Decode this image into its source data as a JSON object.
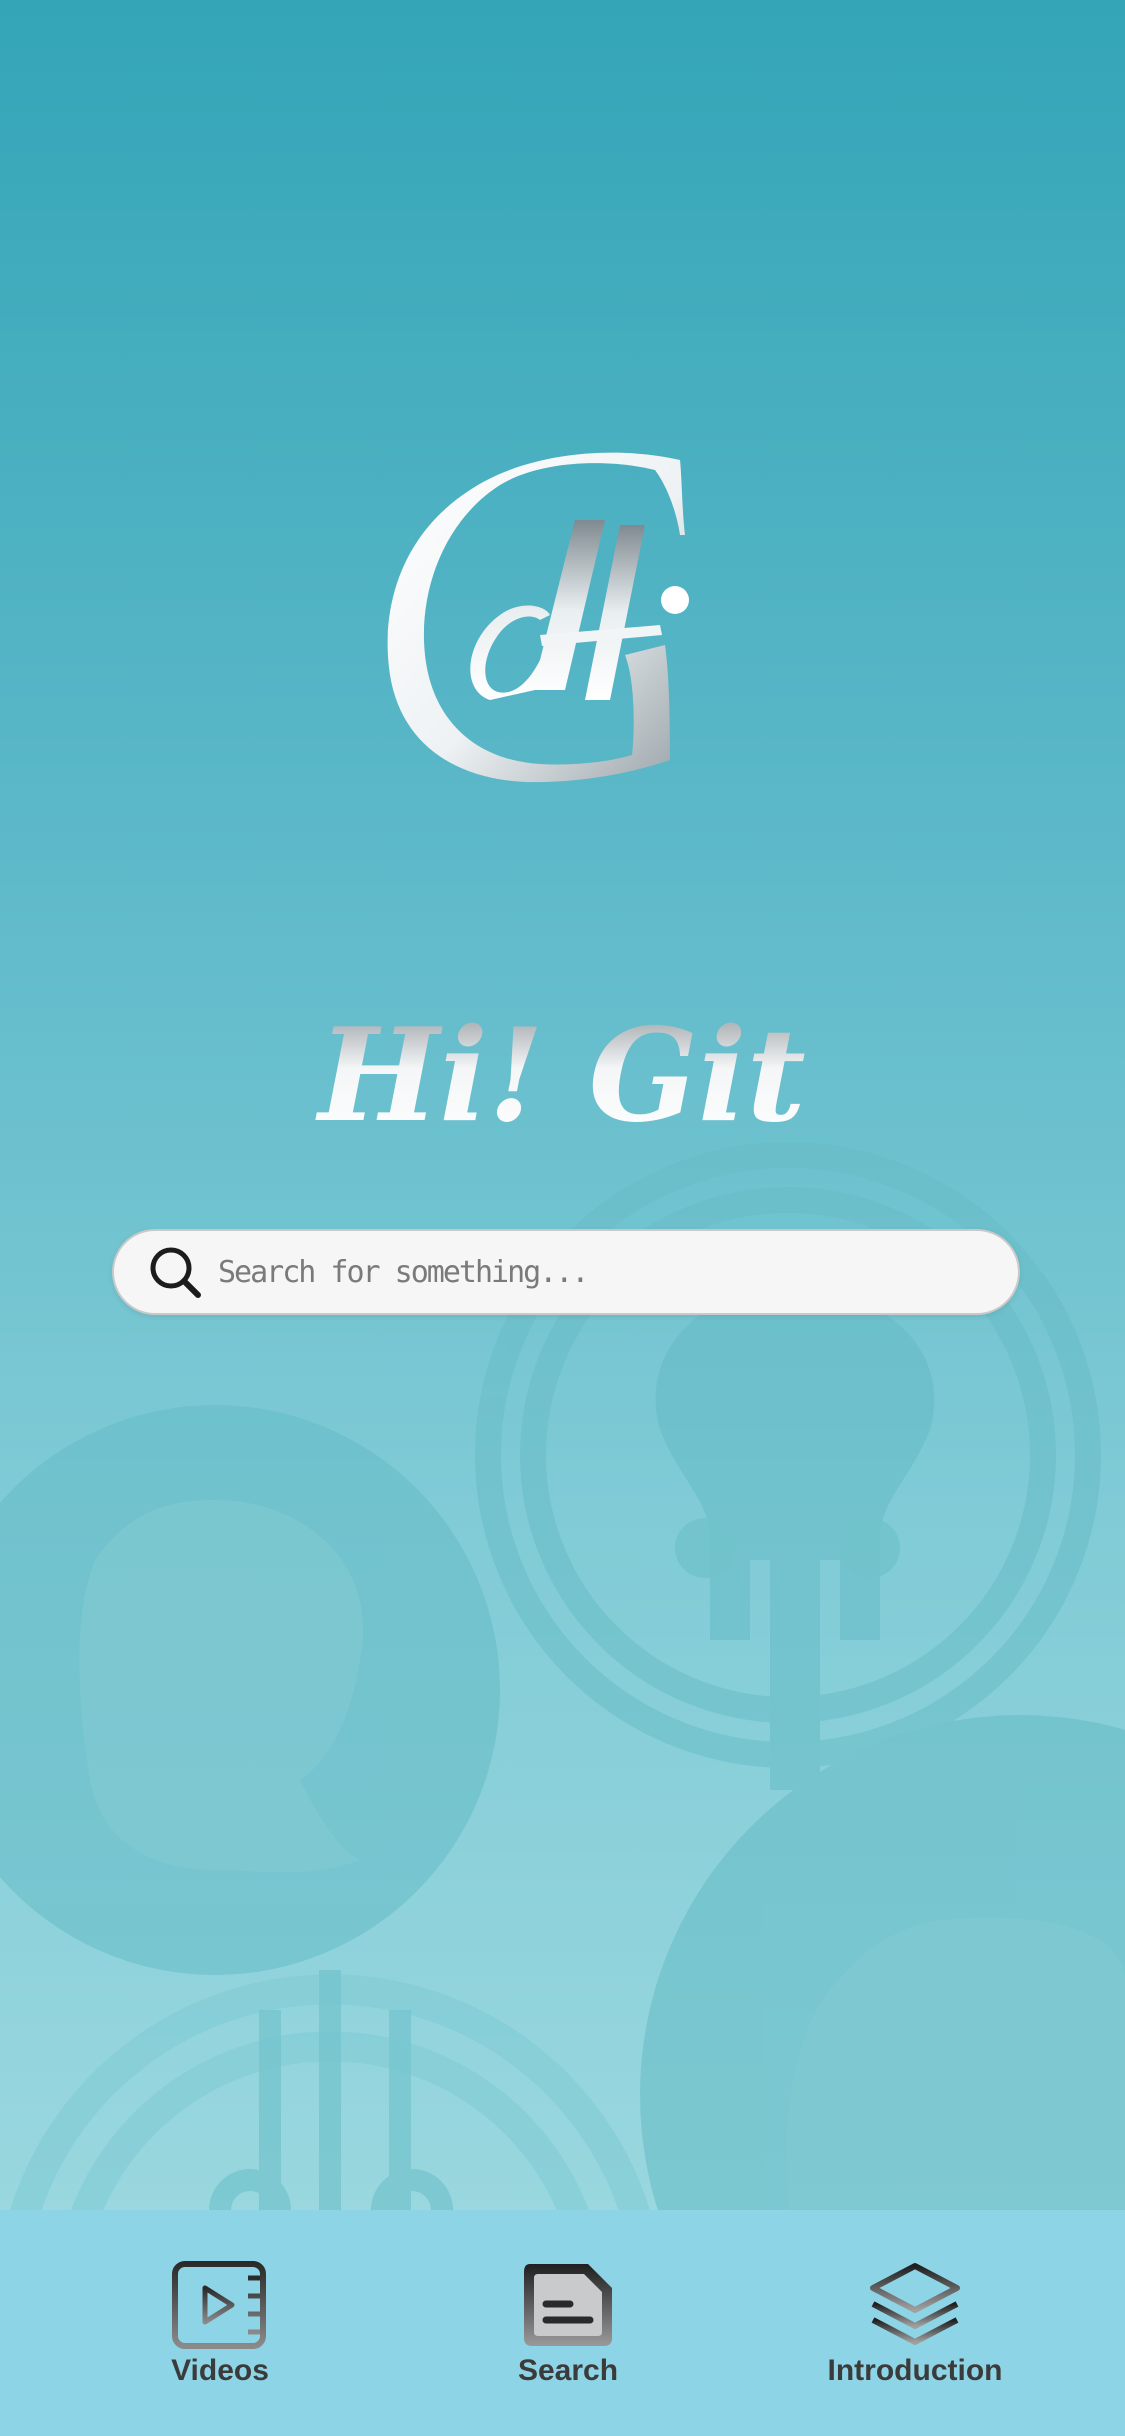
{
  "app": {
    "name": "Hi! Git",
    "logo_letters": "HG"
  },
  "search": {
    "placeholder": "Search for something..."
  },
  "tabbar": {
    "tabs": [
      {
        "label": "Videos",
        "icon": "play-video-icon"
      },
      {
        "label": "Search",
        "icon": "document-search-icon"
      },
      {
        "label": "Introduction",
        "icon": "layers-icon"
      }
    ]
  },
  "colors": {
    "background_top": "#33a5b7",
    "background_bottom": "#a2dbe2",
    "tabbar": "#8dd4e6",
    "search_field": "#f6f6f6",
    "label": "#3b3b3b"
  }
}
